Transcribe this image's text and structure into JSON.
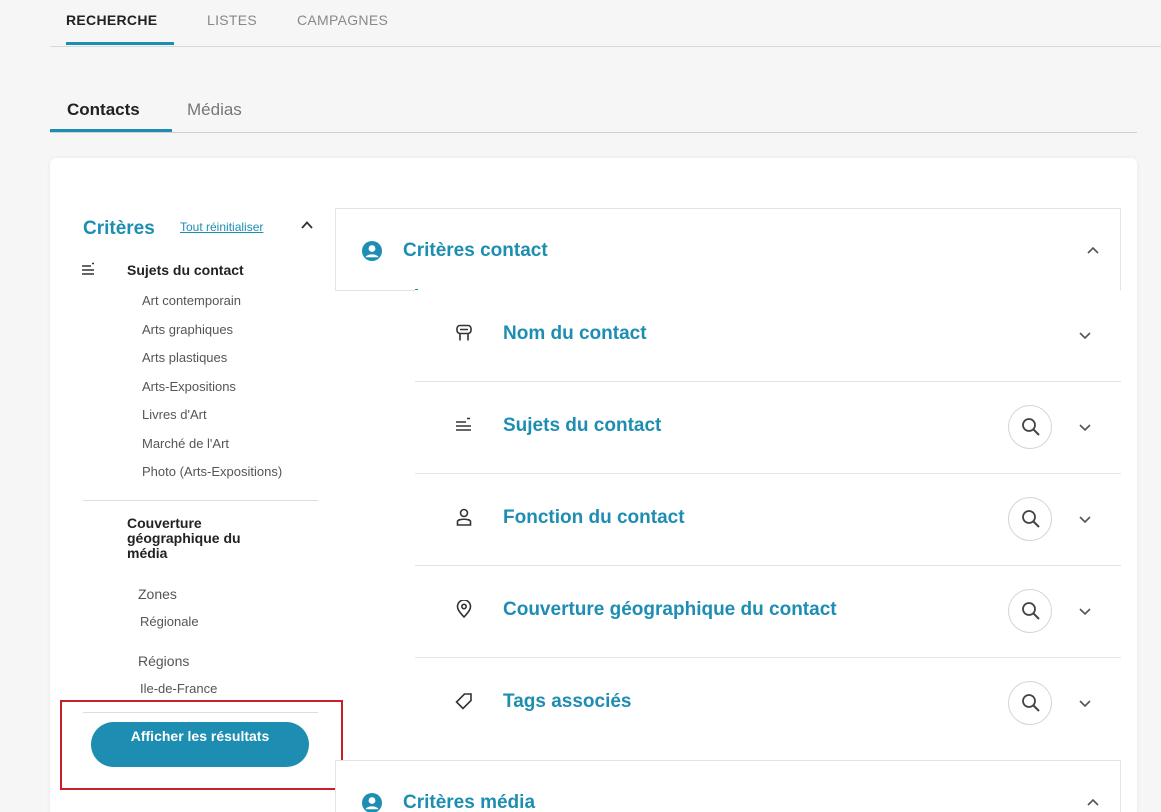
{
  "top_tabs": [
    "RECHERCHE",
    "LISTES",
    "CAMPAGNES"
  ],
  "sub_tabs": [
    "Contacts",
    "Médias"
  ],
  "sidebar": {
    "title": "Critères",
    "reset_label": "Tout réinitialiser",
    "subjects_title": "Sujets du contact",
    "subjects": [
      "Art contemporain",
      "Arts graphiques",
      "Arts plastiques",
      "Arts-Expositions",
      "Livres d'Art",
      "Marché de l'Art",
      "Photo (Arts-Expositions)"
    ],
    "geo_title": "Couverture géographique du média",
    "zones_label": "Zones",
    "zones_value": "Régionale",
    "regions_label": "Régions",
    "regions_value": "Ile-de-France",
    "show_results_label": "Afficher les résultats"
  },
  "contact_criteria": {
    "title": "Critères contact",
    "items": [
      {
        "label": "Nom du contact",
        "icon": "id-badge-icon",
        "search": false
      },
      {
        "label": "Sujets du contact",
        "icon": "list-icon",
        "search": true
      },
      {
        "label": "Fonction du contact",
        "icon": "person-icon",
        "search": true
      },
      {
        "label": "Couverture géographique du contact",
        "icon": "location-pin-icon",
        "search": true
      },
      {
        "label": "Tags associés",
        "icon": "tag-icon",
        "search": true
      }
    ]
  },
  "media_criteria": {
    "title": "Critères média"
  },
  "colors": {
    "accent": "#1d8eb2",
    "highlight_box": "#c8202a"
  }
}
